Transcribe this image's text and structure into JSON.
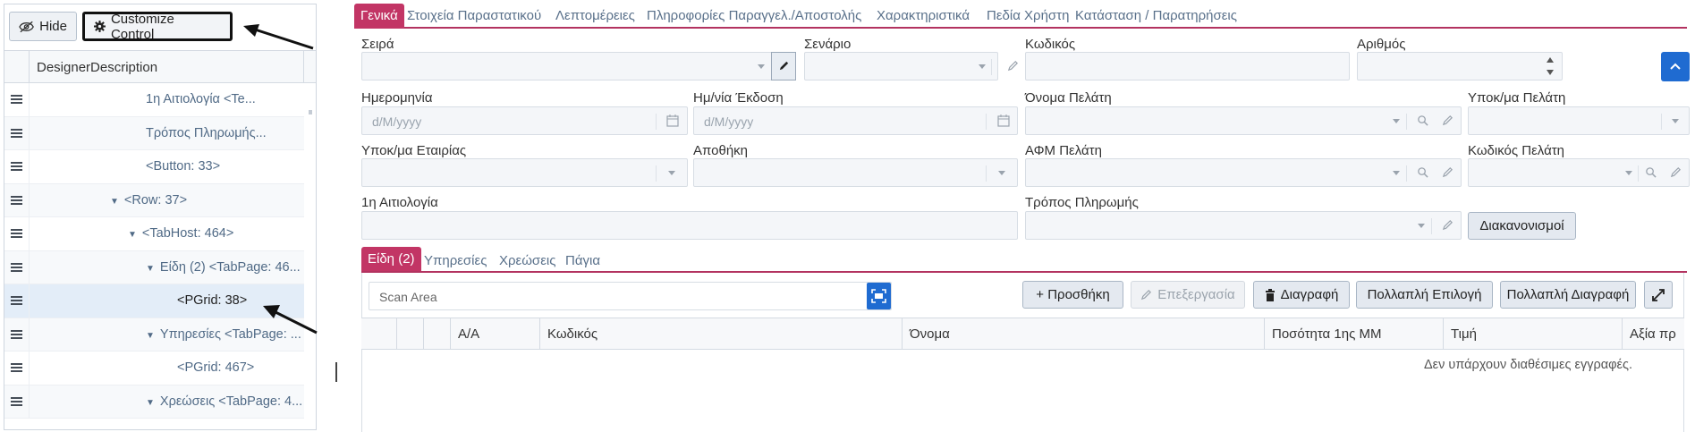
{
  "left_panel": {
    "hide_label": "Hide",
    "customize_label": "Customize Control",
    "column_header": "DesignerDescription",
    "rows": [
      {
        "label": "1η Αιτιολογία <Te..."
      },
      {
        "label": "Τρόπος Πληρωμής..."
      },
      {
        "label": "<Button: 33>"
      },
      {
        "label": "<Row: 37>"
      },
      {
        "label": "<TabHost: 464>"
      },
      {
        "label": "Είδη (2) <TabPage: 46..."
      },
      {
        "label": "<PGrid: 38>"
      },
      {
        "label": "Υπηρεσίες <TabPage: ..."
      },
      {
        "label": "<PGrid: 467>"
      },
      {
        "label": "Χρεώσεις <TabPage: 4..."
      }
    ]
  },
  "main_tabs": [
    {
      "label": "Γενικά"
    },
    {
      "label": "Στοιχεία Παραστατικού"
    },
    {
      "label": "Λεπτομέρειες"
    },
    {
      "label": "Πληροφορίες Παραγγελ./Αποστολής"
    },
    {
      "label": "Χαρακτηριστικά"
    },
    {
      "label": "Πεδία Χρήστη"
    },
    {
      "label": "Κατάσταση / Παρατηρήσεις"
    }
  ],
  "form": {
    "seira_label": "Σειρά",
    "senario_label": "Σενάριο",
    "kodikos_label": "Κωδικός",
    "arithmos_label": "Αριθμός",
    "date_label": "Ημερομηνία",
    "date_placeholder": "d/M/yyyy",
    "issue_date_label": "Ημ/νία Έκδοση",
    "issue_date_placeholder": "d/M/yyyy",
    "customer_name_label": "Όνομα Πελάτη",
    "customer_branch_label": "Υποκ/μα Πελάτη",
    "company_branch_label": "Υποκ/μα Εταιρίας",
    "warehouse_label": "Αποθήκη",
    "customer_vat_label": "ΑΦΜ Πελάτη",
    "customer_code_label": "Κωδικός Πελάτη",
    "reason_label": "1η Αιτιολογία",
    "payment_label": "Τρόπος Πληρωμής",
    "settlements_button": "Διακανονισμοί"
  },
  "sub_tabs": [
    {
      "label": "Είδη (2)"
    },
    {
      "label": "Υπηρεσίες"
    },
    {
      "label": "Χρεώσεις"
    },
    {
      "label": "Πάγια"
    }
  ],
  "grid_toolbar": {
    "scan_placeholder": "Scan Area",
    "add_label": "+ Προσθήκη",
    "edit_label": "Επεξεργασία",
    "delete_label": "Διαγραφή",
    "multi_select_label": "Πολλαπλή Επιλογή",
    "multi_delete_label": "Πολλαπλή Διαγραφή"
  },
  "grid": {
    "columns": [
      "Α/Α",
      "Κωδικός",
      "Όνομα",
      "Ποσότητα 1ης ΜΜ",
      "Τιμή",
      "Αξία πρ"
    ],
    "empty_message": "Δεν υπάρχουν διαθέσιμες εγγραφές."
  },
  "colors": {
    "accent": "#c23565",
    "primary_button": "#1f6bd1"
  }
}
